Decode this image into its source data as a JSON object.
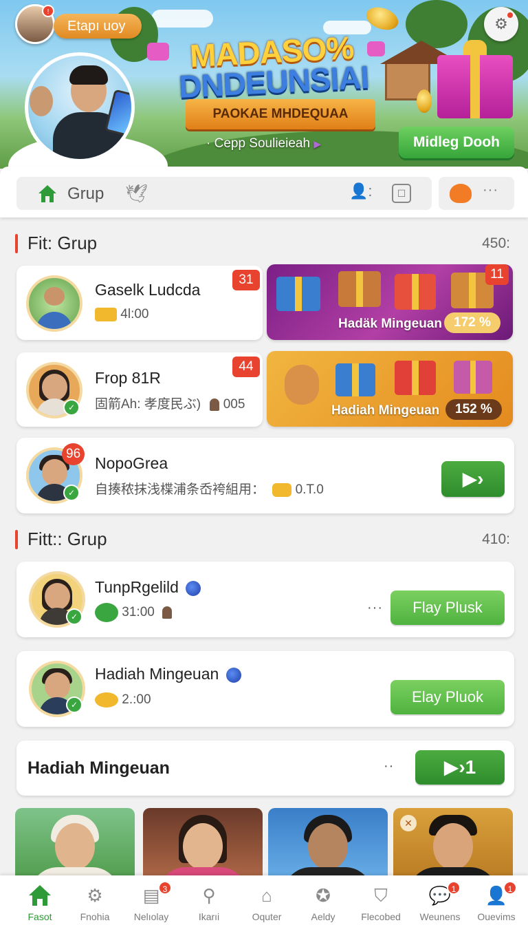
{
  "header": {
    "user_label": "Etapı uoy",
    "avatar_badge": "!",
    "promo_title_line1": "MADASO%",
    "promo_title_line2": "DNDEUNSIAI",
    "promo_ribbon": "PAOKAE MHDEQUAA",
    "promo_sub": "· Cepp Soulieieah",
    "promo_button": "Midleg Dooh"
  },
  "toolbar": {
    "tab_label": "Grup",
    "more_label": "···"
  },
  "section1": {
    "title": "Fit: Grup",
    "count": "450:",
    "rows": [
      {
        "name": "Gaselk Ludcda",
        "meta": "4l:00",
        "badge": "31",
        "promo_label": "Hadäk Mingeuan",
        "promo_pct": "172 %",
        "promo_badge": "11"
      },
      {
        "name": "Frop 81R",
        "meta": "固箭Ah:  孝度民ぶ)",
        "meta_extra": "005",
        "badge": "44",
        "promo_label": "Hadiah Mingeuan",
        "promo_pct": "152 %"
      },
      {
        "name": "NopoGrea",
        "meta": "自揍秾抹浅楪浦条岙袴組用：",
        "meta_extra": "0.T.0",
        "badge": "96",
        "button": "▶›"
      }
    ]
  },
  "section2": {
    "title": "Fitt:: Grup",
    "count": "410:",
    "rows": [
      {
        "name": "TunpRgelild",
        "meta": "31:00",
        "more": "···",
        "button": "Flay Plusk"
      },
      {
        "name": "Hadiah Mingeuan",
        "meta": "2.:00",
        "button": "Elay Pluok"
      }
    ],
    "footer_title": "Hadiah Mingeuan",
    "footer_more": "··",
    "footer_button": "▶›1"
  },
  "bottom_nav": [
    {
      "label": "Fasot",
      "icon": "home-icon",
      "badge": ""
    },
    {
      "label": "Fnohia",
      "icon": "gear-icon",
      "badge": ""
    },
    {
      "label": "Nelıolay",
      "icon": "newspaper-icon",
      "badge": "3"
    },
    {
      "label": "Ikarıi",
      "icon": "search-icon",
      "badge": ""
    },
    {
      "label": "Oquter",
      "icon": "house-icon",
      "badge": ""
    },
    {
      "label": "Aeldy",
      "icon": "badge-icon",
      "badge": ""
    },
    {
      "label": "Flecobed",
      "icon": "shield-icon",
      "badge": ""
    },
    {
      "label": "Weunens",
      "icon": "chat-icon",
      "badge": "1"
    },
    {
      "label": "Ouevims",
      "icon": "profile-icon",
      "badge": "1"
    }
  ],
  "colors": {
    "accent_green": "#3aa640",
    "badge_red": "#e8432e",
    "promo_purple": "#8b2a8f",
    "promo_orange": "#e9a22c"
  }
}
